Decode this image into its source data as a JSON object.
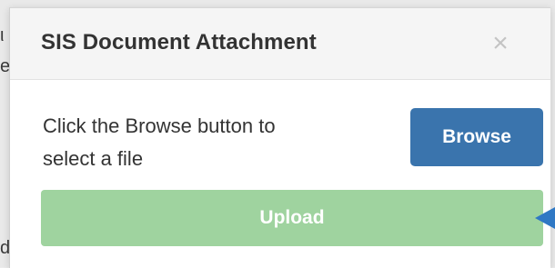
{
  "background": {
    "edge_glyphs": [
      "ι",
      "e",
      "d"
    ]
  },
  "modal": {
    "title": "SIS Document Attachment",
    "close_glyph": "×",
    "instruction_line1": "Click the Browse button to",
    "instruction_line2": "select a file",
    "browse_label": "Browse",
    "upload_label": "Upload"
  },
  "colors": {
    "browse_button": "#3a74ad",
    "upload_button": "#9fd39f",
    "pointer_arrow": "#2f78c4"
  },
  "icons": {
    "close": "close-icon",
    "pointer": "pointer-arrow-icon"
  }
}
